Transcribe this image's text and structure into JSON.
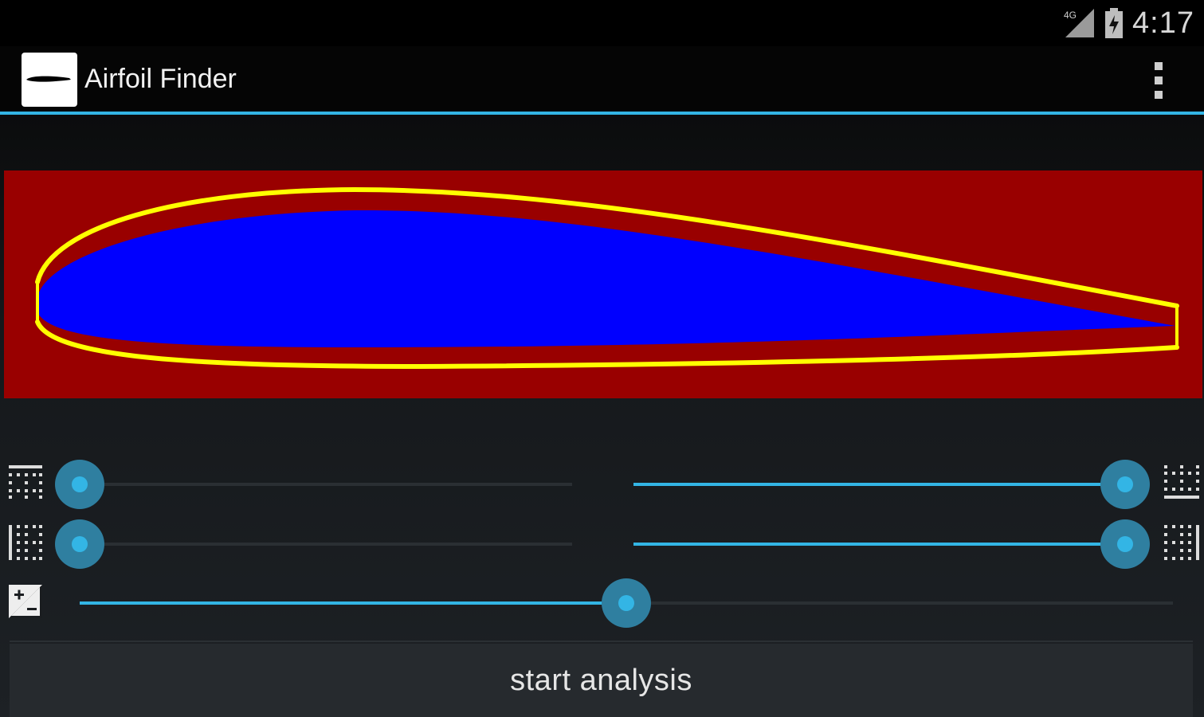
{
  "status_bar": {
    "network_label": "4G",
    "time": "4:17"
  },
  "action_bar": {
    "title": "Airfoil Finder",
    "icons": {
      "app": "airfoil-logo-icon",
      "overflow": "overflow-menu-icon"
    }
  },
  "colors": {
    "accent": "#33b5e5",
    "airfoil_background": "#990000",
    "airfoil_fill": "#0000ff",
    "airfoil_outline": "#ffff00"
  },
  "sliders": [
    {
      "name": "top-grid-slider-left",
      "icon": "grid-top-icon",
      "value": 0.0
    },
    {
      "name": "top-grid-slider-right",
      "icon": "grid-bottom-icon",
      "value": 1.0
    },
    {
      "name": "side-grid-slider-left",
      "icon": "grid-left-icon",
      "value": 0.0
    },
    {
      "name": "side-grid-slider-right",
      "icon": "grid-right-icon",
      "value": 1.0
    },
    {
      "name": "contrast-slider",
      "icon": "exposure-icon",
      "value": 0.5
    }
  ],
  "start_button": {
    "label": "start analysis"
  }
}
